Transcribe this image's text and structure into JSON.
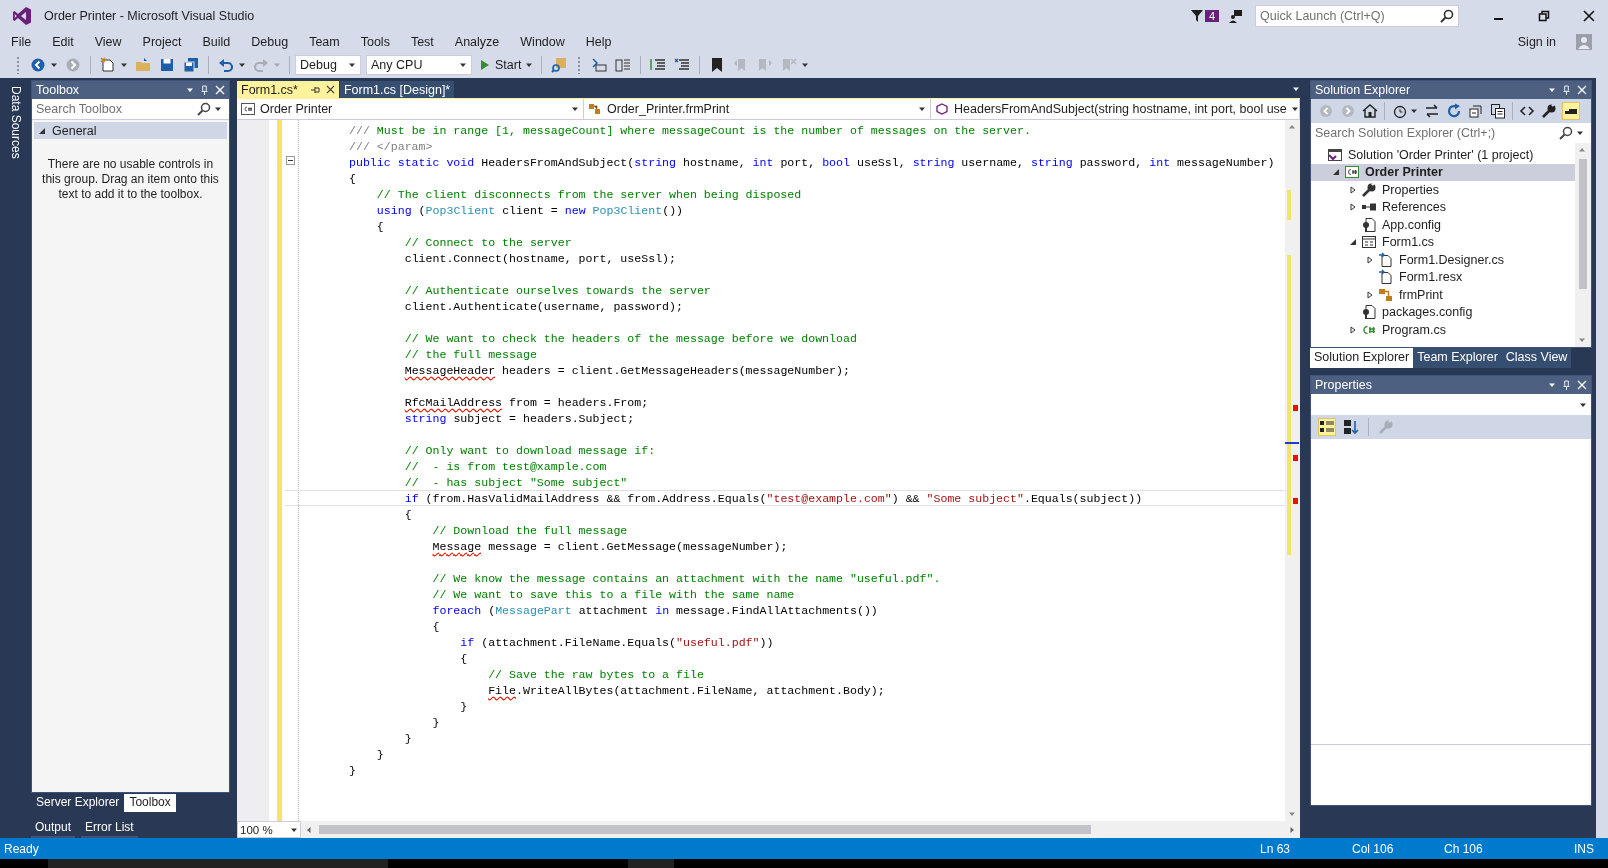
{
  "window": {
    "title": "Order Printer - Microsoft Visual Studio",
    "notification_count": "4",
    "quick_launch": {
      "placeholder": "Quick Launch (Ctrl+Q)"
    },
    "sign_in": "Sign in"
  },
  "menu": [
    "File",
    "Edit",
    "View",
    "Project",
    "Build",
    "Debug",
    "Team",
    "Tools",
    "Test",
    "Analyze",
    "Window",
    "Help"
  ],
  "toolbar": {
    "configuration": "Debug",
    "platform": "Any CPU",
    "start": "Start"
  },
  "side_strip": {
    "label": "Data Sources"
  },
  "toolbox": {
    "title": "Toolbox",
    "search": {
      "placeholder": "Search Toolbox"
    },
    "group": {
      "label": "General",
      "expanded": true
    },
    "message": "There are no usable controls in this group. Drag an item onto this text to add it to the toolbox.",
    "tabs": [
      {
        "label": "Server Explorer",
        "selected": false
      },
      {
        "label": "Toolbox",
        "selected": true
      }
    ]
  },
  "bottom_tabs": [
    "Output",
    "Error List"
  ],
  "editor": {
    "tabs": [
      {
        "label": "Form1.cs*",
        "selected": true
      },
      {
        "label": "Form1.cs [Design]*",
        "selected": false
      }
    ],
    "nav": [
      "Order Printer",
      "Order_Printer.frmPrint",
      "HeadersFromAndSubject(string hostname, int port, bool use"
    ],
    "zoom": "100 %",
    "lines": [
      {
        "current": false,
        "tokens": [
          {
            "kind": "doc",
            "text": "/// "
          },
          {
            "kind": "comment",
            "text": "Must be in range [1, messageCount] where messageCount is the number of messages on the server."
          }
        ]
      },
      {
        "current": false,
        "tokens": [
          {
            "kind": "doc",
            "text": "/// </param>"
          }
        ]
      },
      {
        "current": false,
        "tokens": [
          {
            "kind": "keyword",
            "text": "public static void"
          },
          {
            "kind": "plain",
            "text": " HeadersFromAndSubject("
          },
          {
            "kind": "keyword",
            "text": "string"
          },
          {
            "kind": "plain",
            "text": " hostname, "
          },
          {
            "kind": "keyword",
            "text": "int"
          },
          {
            "kind": "plain",
            "text": " port, "
          },
          {
            "kind": "keyword",
            "text": "bool"
          },
          {
            "kind": "plain",
            "text": " useSsl, "
          },
          {
            "kind": "keyword",
            "text": "string"
          },
          {
            "kind": "plain",
            "text": " username, "
          },
          {
            "kind": "keyword",
            "text": "string"
          },
          {
            "kind": "plain",
            "text": " password, "
          },
          {
            "kind": "keyword",
            "text": "int"
          },
          {
            "kind": "plain",
            "text": " messageNumber)"
          }
        ]
      },
      {
        "current": false,
        "tokens": [
          {
            "kind": "plain",
            "text": "{"
          }
        ]
      },
      {
        "current": false,
        "tokens": [
          {
            "kind": "comment",
            "text": "    // The client disconnects from the server when being disposed"
          }
        ]
      },
      {
        "current": false,
        "tokens": [
          {
            "kind": "keyword",
            "text": "    using"
          },
          {
            "kind": "plain",
            "text": " ("
          },
          {
            "kind": "type",
            "text": "Pop3Client"
          },
          {
            "kind": "plain",
            "text": " client = "
          },
          {
            "kind": "keyword",
            "text": "new "
          },
          {
            "kind": "type",
            "text": "Pop3Client"
          },
          {
            "kind": "plain",
            "text": "())"
          }
        ]
      },
      {
        "current": false,
        "tokens": [
          {
            "kind": "plain",
            "text": "    {"
          }
        ]
      },
      {
        "current": false,
        "tokens": [
          {
            "kind": "comment",
            "text": "        // Connect to the server"
          }
        ]
      },
      {
        "current": false,
        "tokens": [
          {
            "kind": "plain",
            "text": "        client.Connect(hostname, port, useSsl);"
          }
        ]
      },
      {
        "current": false
      },
      {
        "current": false,
        "tokens": [
          {
            "kind": "comment",
            "text": "        // Authenticate ourselves towards the server"
          }
        ]
      },
      {
        "current": false,
        "tokens": [
          {
            "kind": "plain",
            "text": "        client.Authenticate(username, password);"
          }
        ]
      },
      {
        "current": false
      },
      {
        "current": false,
        "tokens": [
          {
            "kind": "comment",
            "text": "        // We want to check the headers of the message before we download"
          }
        ]
      },
      {
        "current": false,
        "tokens": [
          {
            "kind": "comment",
            "text": "        // the full message"
          }
        ]
      },
      {
        "current": false,
        "tokens": [
          {
            "kind": "error",
            "text": "        MessageHeader"
          },
          {
            "kind": "plain",
            "text": " headers = client.GetMessageHeaders(messageNumber);"
          }
        ]
      },
      {
        "current": false
      },
      {
        "current": false,
        "tokens": [
          {
            "kind": "error",
            "text": "        RfcMailAddress"
          },
          {
            "kind": "plain",
            "text": " from = headers.From;"
          }
        ]
      },
      {
        "current": false,
        "tokens": [
          {
            "kind": "keyword",
            "text": "        string"
          },
          {
            "kind": "plain",
            "text": " subject = headers.Subject;"
          }
        ]
      },
      {
        "current": false
      },
      {
        "current": false,
        "tokens": [
          {
            "kind": "comment",
            "text": "        // Only want to download message if:"
          }
        ]
      },
      {
        "current": false,
        "tokens": [
          {
            "kind": "comment",
            "text": "        //  - is from test@xample.com"
          }
        ]
      },
      {
        "current": false,
        "tokens": [
          {
            "kind": "comment",
            "text": "        //  - has subject \"Some subject\""
          }
        ]
      },
      {
        "current": true,
        "tokens": [
          {
            "kind": "keyword",
            "text": "        if"
          },
          {
            "kind": "plain",
            "text": " (from.HasValidMailAddress && from.Address.Equals("
          },
          {
            "kind": "string",
            "text": "\"test@example.com\""
          },
          {
            "kind": "plain",
            "text": ") && "
          },
          {
            "kind": "string",
            "text": "\"Some subject\""
          },
          {
            "kind": "plain",
            "text": ".Equals(subject))"
          }
        ]
      },
      {
        "current": false,
        "tokens": [
          {
            "kind": "plain",
            "text": "        {"
          }
        ]
      },
      {
        "current": false,
        "tokens": [
          {
            "kind": "comment",
            "text": "            // Download the full message"
          }
        ]
      },
      {
        "current": false,
        "tokens": [
          {
            "kind": "error",
            "text": "            Message"
          },
          {
            "kind": "plain",
            "text": " message = client.GetMessage(messageNumber);"
          }
        ]
      },
      {
        "current": false
      },
      {
        "current": false,
        "tokens": [
          {
            "kind": "comment",
            "text": "            // We know the message contains an attachment with the name \"useful.pdf\"."
          }
        ]
      },
      {
        "current": false,
        "tokens": [
          {
            "kind": "comment",
            "text": "            // We want to save this to a file with the same name"
          }
        ]
      },
      {
        "current": false,
        "tokens": [
          {
            "kind": "keyword",
            "text": "            foreach"
          },
          {
            "kind": "plain",
            "text": " ("
          },
          {
            "kind": "type",
            "text": "MessagePart"
          },
          {
            "kind": "plain",
            "text": " attachment "
          },
          {
            "kind": "keyword",
            "text": "in"
          },
          {
            "kind": "plain",
            "text": " message.FindAllAttachments())"
          }
        ]
      },
      {
        "current": false,
        "tokens": [
          {
            "kind": "plain",
            "text": "            {"
          }
        ]
      },
      {
        "current": false,
        "tokens": [
          {
            "kind": "keyword",
            "text": "                if"
          },
          {
            "kind": "plain",
            "text": " (attachment.FileName.Equals("
          },
          {
            "kind": "string",
            "text": "\"useful.pdf\""
          },
          {
            "kind": "plain",
            "text": "))"
          }
        ]
      },
      {
        "current": false,
        "tokens": [
          {
            "kind": "plain",
            "text": "                {"
          }
        ]
      },
      {
        "current": false,
        "tokens": [
          {
            "kind": "comment",
            "text": "                    // Save the raw bytes to a file"
          }
        ]
      },
      {
        "current": false,
        "tokens": [
          {
            "kind": "error",
            "text": "                    File"
          },
          {
            "kind": "plain",
            "text": ".WriteAllBytes(attachment.FileName, attachment.Body);"
          }
        ]
      },
      {
        "current": false,
        "tokens": [
          {
            "kind": "plain",
            "text": "                }"
          }
        ]
      },
      {
        "current": false,
        "tokens": [
          {
            "kind": "plain",
            "text": "            }"
          }
        ]
      },
      {
        "current": false,
        "tokens": [
          {
            "kind": "plain",
            "text": "        }"
          }
        ]
      },
      {
        "current": false,
        "tokens": [
          {
            "kind": "plain",
            "text": "    }"
          }
        ]
      },
      {
        "current": false,
        "tokens": [
          {
            "kind": "plain",
            "text": "}"
          }
        ]
      }
    ]
  },
  "solution_explorer": {
    "title": "Solution Explorer",
    "search": {
      "placeholder": "Search Solution Explorer (Ctrl+;)"
    },
    "tree": [
      {
        "label": "Solution 'Order Printer' (1 project)",
        "kind": "solution",
        "selected": false,
        "children": [
          {
            "label": "Order Printer",
            "kind": "project",
            "selected": true,
            "expanded": true,
            "children": [
              {
                "label": "Properties",
                "kind": "wrench",
                "selected": false,
                "expanded": false
              },
              {
                "label": "References",
                "kind": "references",
                "selected": false,
                "expanded": false
              },
              {
                "label": "App.config",
                "kind": "config",
                "selected": false
              },
              {
                "label": "Form1.cs",
                "kind": "form",
                "selected": false,
                "expanded": true,
                "children": [
                  {
                    "label": "Form1.Designer.cs",
                    "kind": "file",
                    "selected": false,
                    "expanded": false
                  },
                  {
                    "label": "Form1.resx",
                    "kind": "file",
                    "selected": false
                  },
                  {
                    "label": "frmPrint",
                    "kind": "component",
                    "selected": false,
                    "expanded": false
                  }
                ]
              },
              {
                "label": "packages.config",
                "kind": "config",
                "selected": false
              },
              {
                "label": "Program.cs",
                "kind": "csharp",
                "selected": false,
                "expanded": false
              }
            ]
          }
        ]
      }
    ],
    "tabs": [
      {
        "label": "Solution Explorer",
        "selected": true
      },
      {
        "label": "Team Explorer",
        "selected": false
      },
      {
        "label": "Class View",
        "selected": false
      }
    ]
  },
  "properties": {
    "title": "Properties"
  },
  "status_bar": {
    "state": "Ready",
    "line": "Ln 63",
    "column": "Col 106",
    "char": "Ch 106",
    "mode": "INS"
  }
}
